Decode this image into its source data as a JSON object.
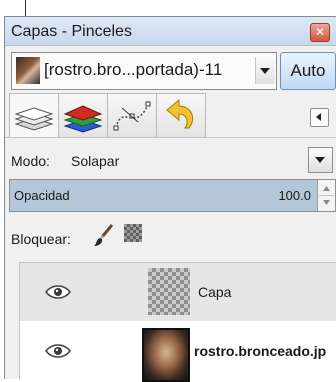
{
  "panel": {
    "title": "Capas - Pinceles",
    "close_icon": "close-icon",
    "accent": "#6b8fbf",
    "close_color": "#d0573f"
  },
  "image_selector": {
    "value": "[rostro.bro...portada)-11",
    "auto_label": "Auto"
  },
  "tabs": [
    {
      "name": "layers-icon",
      "active": true
    },
    {
      "name": "channels-icon",
      "active": false
    },
    {
      "name": "paths-icon",
      "active": false
    },
    {
      "name": "undo-history-icon",
      "active": false
    }
  ],
  "mode": {
    "label": "Modo:",
    "value": "Solapar"
  },
  "opacity": {
    "label": "Opacidad",
    "value": "100.0",
    "fraction": 1.0
  },
  "lock": {
    "label": "Bloquear:",
    "icons": [
      "paintbrush-icon",
      "alpha-checker-icon"
    ]
  },
  "layers": [
    {
      "name": "Capa",
      "visible": true,
      "selected": true,
      "thumbnail": "transparent"
    },
    {
      "name": "rostro.bronceado.jp",
      "visible": true,
      "selected": false,
      "thumbnail": "photo"
    }
  ]
}
